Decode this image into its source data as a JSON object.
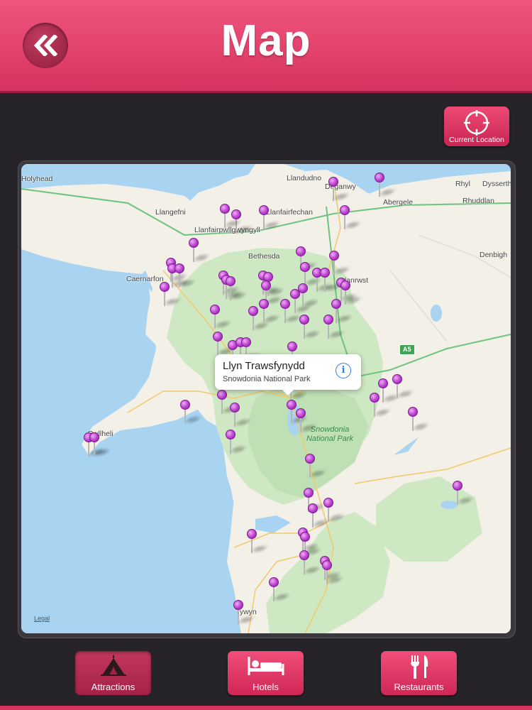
{
  "header": {
    "title": "Map",
    "back_icon": "double-chevron-left-icon"
  },
  "current_location": {
    "label": "Current Location",
    "icon": "crosshair-icon"
  },
  "map": {
    "places": [
      "Llandudno",
      "Deganwy",
      "Rhyl",
      "Dysserth",
      "Abergele",
      "Rhuddlan",
      "Llangefni",
      "Llanfairfechan",
      "Llanfairpwllgwyngyll",
      "Bethesda",
      "Denbigh",
      "Caernarfon",
      "Llanrwst",
      "Pwllheli",
      "Tywyn",
      "Holyhead"
    ],
    "park_label": "Snowdonia National Park",
    "road_badge": "A5",
    "legal": "Legal",
    "pin_color": "#b338c9",
    "callout": {
      "title": "Llyn Trawsfynydd",
      "subtitle": "Snowdonia National Park",
      "icon": "info-icon"
    }
  },
  "tabs": [
    {
      "label": "Attractions",
      "icon": "tent-icon",
      "active": true
    },
    {
      "label": "Hotels",
      "icon": "bed-icon",
      "active": false
    },
    {
      "label": "Restaurants",
      "icon": "fork-knife-icon",
      "active": false
    }
  ],
  "colors": {
    "accent": "#e63e6b",
    "background": "#262429"
  }
}
